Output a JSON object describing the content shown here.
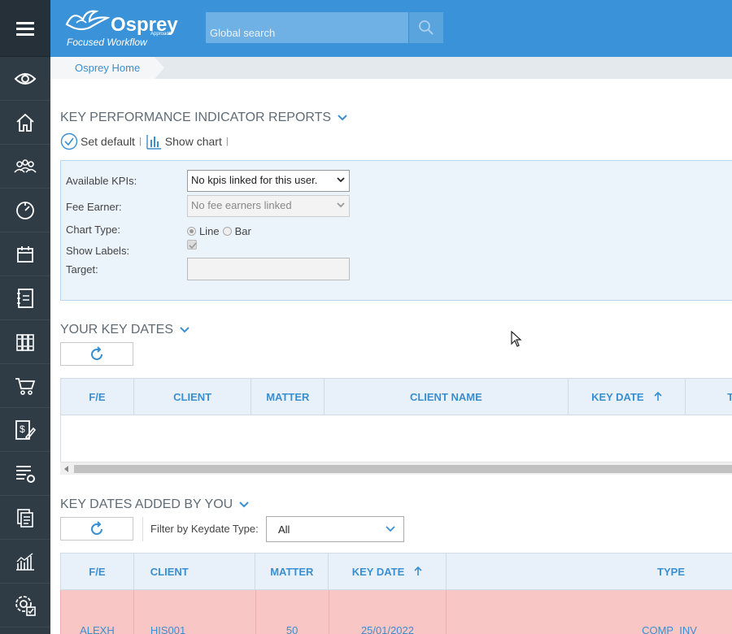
{
  "app": {
    "logo_name": "Osprey",
    "logo_sub": "Approach",
    "tagline": "Focused Workflow",
    "search_placeholder": "Global search"
  },
  "sidebar": {
    "items": [
      {
        "icon": "eye-icon"
      },
      {
        "icon": "home-icon"
      },
      {
        "icon": "people-icon"
      },
      {
        "icon": "dashboard-gauge-icon"
      },
      {
        "icon": "calendar-icon"
      },
      {
        "icon": "address-book-icon"
      },
      {
        "icon": "library-icon"
      },
      {
        "icon": "cart-icon"
      },
      {
        "icon": "billing-edit-icon"
      },
      {
        "icon": "list-settings-icon"
      },
      {
        "icon": "documents-icon"
      },
      {
        "icon": "reports-chart-icon"
      },
      {
        "icon": "admin-settings-icon"
      }
    ]
  },
  "breadcrumb": {
    "home": "Osprey Home"
  },
  "kpi": {
    "title": "KEY PERFORMANCE INDICATOR REPORTS",
    "set_default": "Set default",
    "show_chart": "Show chart",
    "sep": "|",
    "labels": {
      "available": "Available KPIs:",
      "fee_earner": "Fee Earner:",
      "chart_type": "Chart Type:",
      "show_labels": "Show Labels:",
      "target": "Target:"
    },
    "available_value": "No kpis linked for this user.",
    "fee_earner_value": "No fee earners linked",
    "chart_line": "Line",
    "chart_bar": "Bar",
    "selected_chart_type": "Line",
    "show_labels_checked": true,
    "target_value": ""
  },
  "key_dates": {
    "title": "YOUR KEY DATES",
    "columns": [
      "F/E",
      "CLIENT",
      "MATTER",
      "CLIENT NAME",
      "KEY DATE",
      "T"
    ],
    "rows": []
  },
  "added_by_you": {
    "title": "KEY DATES ADDED BY YOU",
    "filter_label": "Filter by Keydate Type:",
    "filter_value": "All",
    "columns": [
      "F/E",
      "CLIENT",
      "MATTER",
      "KEY DATE",
      "TYPE"
    ],
    "rows": [
      {
        "fe": "ALEXH",
        "client": "HIS001",
        "matter": "50",
        "key_date": "25/01/2022",
        "type": "COMP_INV"
      }
    ]
  },
  "colors": {
    "sidebar": "#2f3b45",
    "header": "#3a93d8",
    "accent": "#3a8fd0",
    "highlight_row": "#f9c6c6"
  }
}
